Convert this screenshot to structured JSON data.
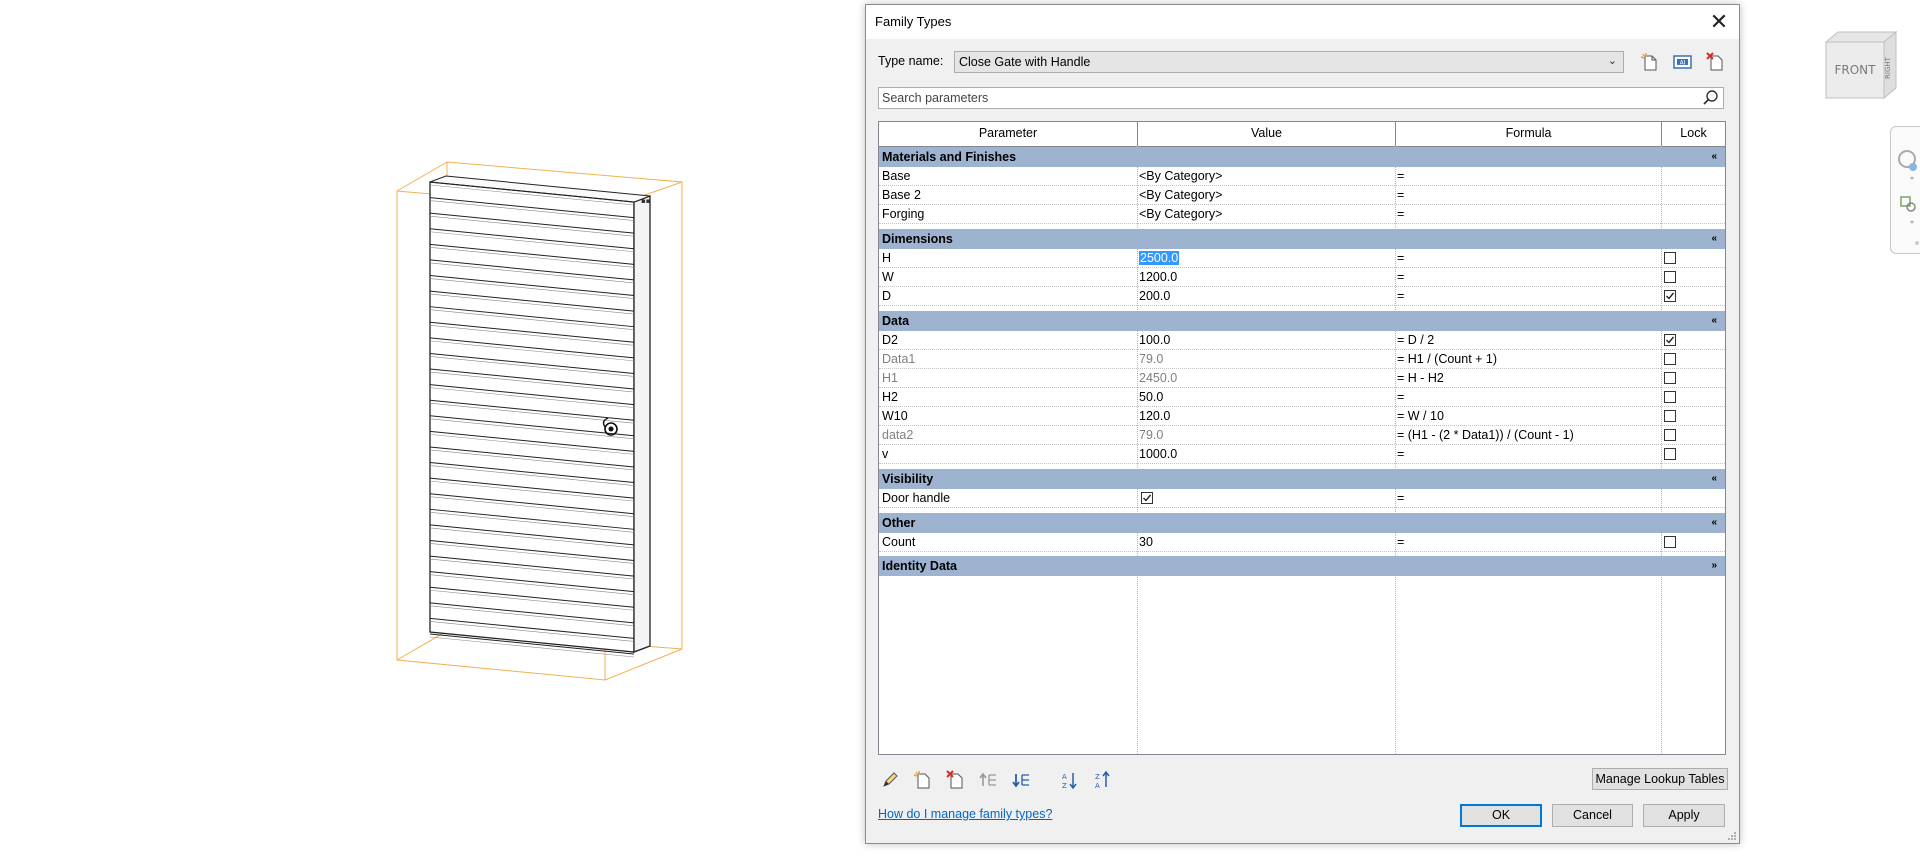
{
  "viewcube": {
    "face_label": "FRONT",
    "side_label": "RIGHT"
  },
  "dialog": {
    "title": "Family Types",
    "close_glyph": "✕",
    "type_name_label": "Type name:",
    "type_name_value": "Close Gate with Handle",
    "toolbar_icons": [
      "new-type-icon",
      "rename-type-icon",
      "delete-type-icon"
    ],
    "search_placeholder": "Search parameters",
    "columns": [
      "Parameter",
      "Value",
      "Formula",
      "Lock"
    ],
    "groups": {
      "materials": {
        "name": "Materials and Finishes",
        "chevron": "«",
        "rows": [
          {
            "param": "Base",
            "value": "<By Category>",
            "formula": "="
          },
          {
            "param": "Base 2",
            "value": "<By Category>",
            "formula": "="
          },
          {
            "param": "Forging",
            "value": "<By Category>",
            "formula": "="
          }
        ]
      },
      "dimensions": {
        "name": "Dimensions",
        "chevron": "«",
        "rows": [
          {
            "param": "H",
            "value": "2500.0",
            "formula": "=",
            "lock": false,
            "selected": true
          },
          {
            "param": "W",
            "value": "1200.0",
            "formula": "=",
            "lock": false
          },
          {
            "param": "D",
            "value": "200.0",
            "formula": "=",
            "lock": true
          }
        ]
      },
      "data": {
        "name": "Data",
        "chevron": "«",
        "rows": [
          {
            "param": "D2",
            "value": "100.0",
            "formula": "= D / 2",
            "lock": true
          },
          {
            "param": "Data1",
            "value": "79.0",
            "formula": "= H1 / (Count + 1)",
            "lock": false,
            "greyed": true
          },
          {
            "param": "H1",
            "value": "2450.0",
            "formula": "= H - H2",
            "lock": false,
            "greyed": true
          },
          {
            "param": "H2",
            "value": "50.0",
            "formula": "=",
            "lock": false
          },
          {
            "param": "W10",
            "value": "120.0",
            "formula": "= W / 10",
            "lock": false
          },
          {
            "param": "data2",
            "value": "79.0",
            "formula": "= (H1 - (2 * Data1)) / (Count - 1)",
            "lock": false,
            "greyed": true
          },
          {
            "param": "v",
            "value": "1000.0",
            "formula": "=",
            "lock": false
          }
        ]
      },
      "visibility": {
        "name": "Visibility",
        "chevron": "«",
        "rows": [
          {
            "param": "Door handle",
            "value_checked": true,
            "formula": "="
          }
        ]
      },
      "other": {
        "name": "Other",
        "chevron": "«",
        "rows": [
          {
            "param": "Count",
            "value": "30",
            "formula": "=",
            "lock": false
          }
        ]
      },
      "identity": {
        "name": "Identity Data",
        "chevron": "»"
      }
    },
    "bottom_icons": [
      "edit-parameter-icon",
      "new-parameter-icon",
      "delete-parameter-icon",
      "move-up-icon",
      "move-down-icon",
      "sort-ascending-icon",
      "sort-descending-icon"
    ],
    "manage_lookup_label": "Manage Lookup Tables",
    "help_link": "How do I manage family types?",
    "ok_label": "OK",
    "cancel_label": "Cancel",
    "apply_label": "Apply"
  }
}
